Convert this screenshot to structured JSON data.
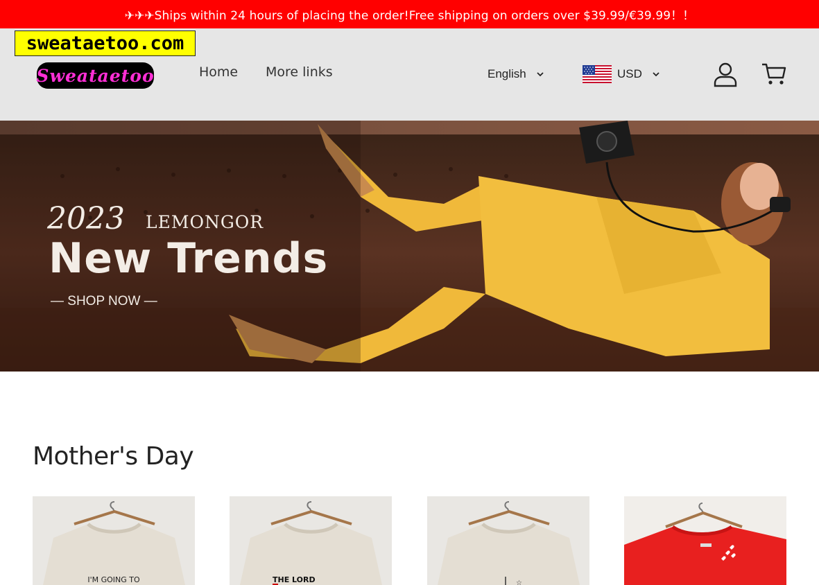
{
  "announcement": {
    "text": "✈✈✈Ships within 24 hours of placing the order!Free shipping on orders over $39.99/€39.99！！"
  },
  "watermark": {
    "text": "sweataetoo.com"
  },
  "header": {
    "logo_text": "Sweataetoo",
    "nav": [
      {
        "label": "Home"
      },
      {
        "label": "More links"
      }
    ],
    "language": {
      "selected": "English"
    },
    "currency": {
      "selected": "USD"
    },
    "icons": {
      "account": "user-icon",
      "cart": "cart-icon",
      "flag": "us-flag-icon",
      "chevron": "chevron-down-icon"
    }
  },
  "hero": {
    "year": "2023",
    "brand": "LEMONGOR",
    "headline": "New Trends",
    "cta": "— SHOP NOW —"
  },
  "collection": {
    "title": "Mother's Day",
    "products": [
      {
        "print_text": "I'M GOING TO",
        "shirt_color": "#e4ded3"
      },
      {
        "print_text": "THE LORD",
        "shirt_color": "#e4ded3"
      },
      {
        "print_text": "",
        "shirt_color": "#e4ded3"
      },
      {
        "print_text": "",
        "shirt_color": "#e8201f"
      }
    ]
  },
  "colors": {
    "announcement_bg": "#ff0000",
    "header_bg": "#e6e6e6",
    "watermark_bg": "#ffff00",
    "logo_text": "#ff2fd6"
  }
}
